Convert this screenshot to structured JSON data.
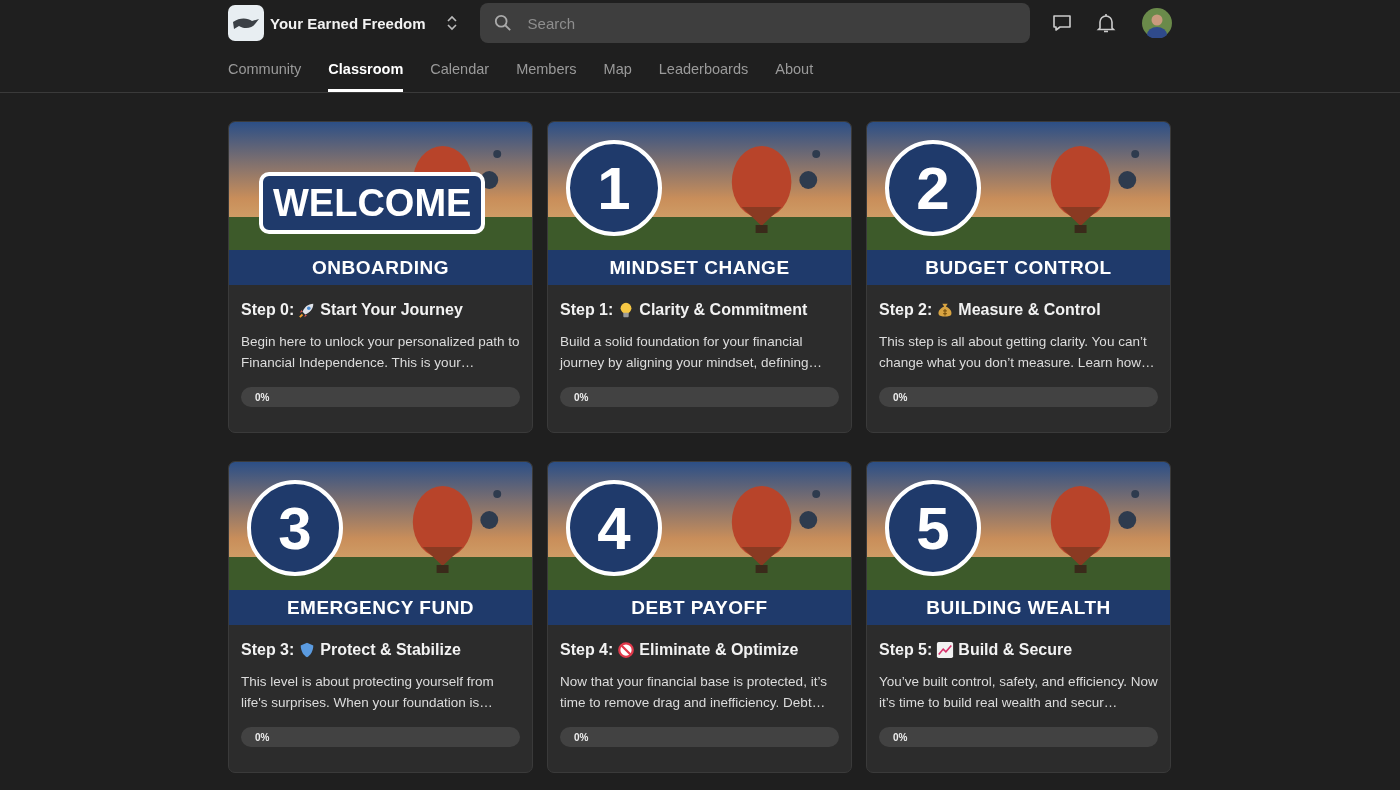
{
  "header": {
    "community_name": "Your Earned Freedom",
    "search": {
      "placeholder": "Search"
    }
  },
  "tabs": [
    {
      "label": "Community",
      "selected": false
    },
    {
      "label": "Classroom",
      "selected": true
    },
    {
      "label": "Calendar",
      "selected": false
    },
    {
      "label": "Members",
      "selected": false
    },
    {
      "label": "Map",
      "selected": false
    },
    {
      "label": "Leaderboards",
      "selected": false
    },
    {
      "label": "About",
      "selected": false
    }
  ],
  "courses": [
    {
      "cover_badge": "WELCOME",
      "kind": "label",
      "cover_banner": "ONBOARDING",
      "title_prefix": "Step 0:",
      "title": "Start Your Journey",
      "description": "Begin here to unlock your personalized path to Financial Independence. This is your…",
      "level": 0,
      "progress": "0%"
    },
    {
      "cover_badge": "1",
      "kind": "number",
      "cover_banner": "MINDSET CHANGE",
      "title_prefix": "Step 1:",
      "title": "Clarity & Commitment",
      "description": "Build a solid foundation for your financial journey by aligning your mindset, defining…",
      "level": 0,
      "progress": "0%"
    },
    {
      "cover_badge": "2",
      "kind": "number",
      "cover_banner": "BUDGET CONTROL",
      "title_prefix": "Step 2:",
      "title": "Measure & Control",
      "description": "This step is all about getting clarity. You can’t change what you don’t measure. Learn how…",
      "level": 0,
      "progress": "0%"
    },
    {
      "cover_badge": "3",
      "kind": "number",
      "cover_banner": "EMERGENCY FUND",
      "title_prefix": "Step 3:",
      "title": "Protect & Stabilize",
      "description": "This level is about protecting yourself from life's surprises. When your foundation is…",
      "level": 0,
      "progress": "0%"
    },
    {
      "cover_badge": "4",
      "kind": "number",
      "cover_banner": "DEBT PAYOFF",
      "title_prefix": "Step 4:",
      "title": "Eliminate & Optimize",
      "description": "Now that your financial base is protected, it’s time to remove drag and inefficiency. Debt…",
      "level": 0,
      "progress": "0%"
    },
    {
      "cover_badge": "5",
      "kind": "number",
      "cover_banner": "BUILDING WEALTH",
      "title_prefix": "Step 5:",
      "title": "Build & Secure",
      "description": "You’ve built control, safety, and efficiency. Now it’s time to build real wealth and secur…",
      "level": 0,
      "progress": "0%"
    }
  ]
}
